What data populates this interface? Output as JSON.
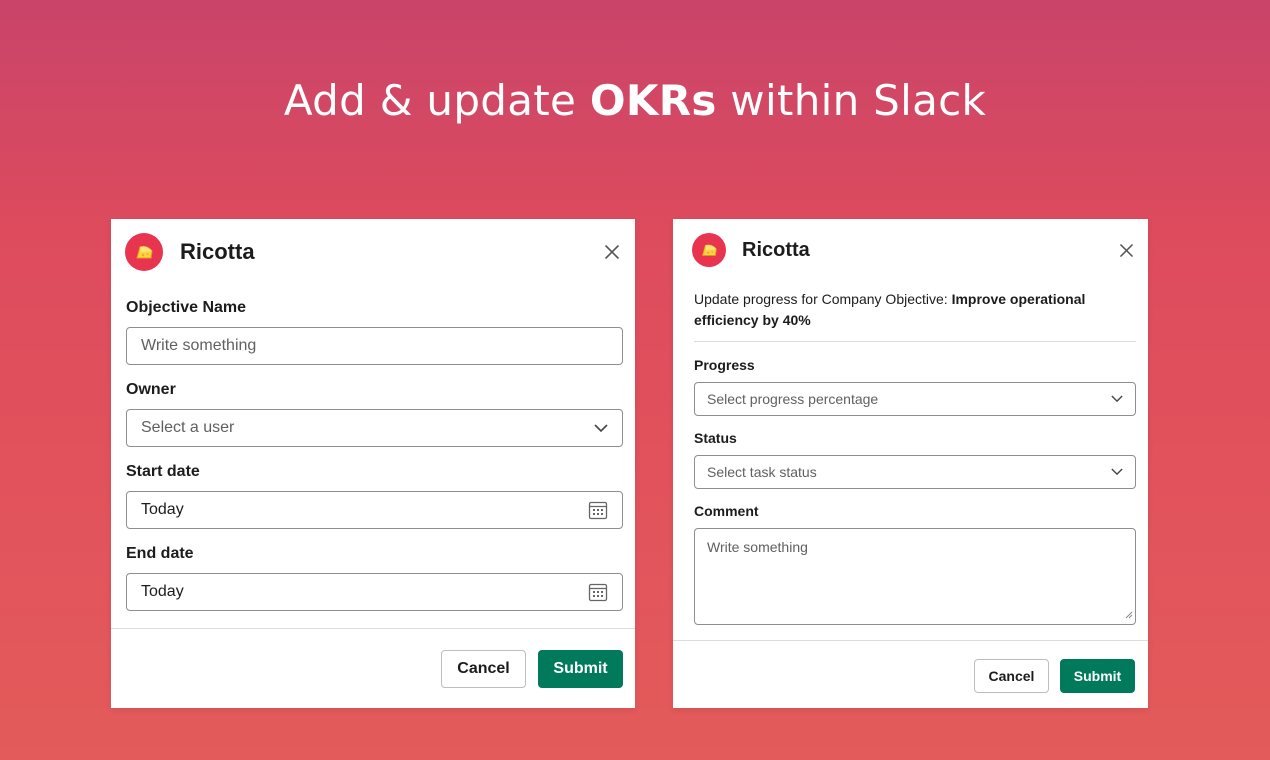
{
  "headline": {
    "pre": "Add & update ",
    "bold": "OKRs",
    "post": " within Slack"
  },
  "left_modal": {
    "app_name": "Ricotta",
    "fields": {
      "objective_label": "Objective Name",
      "objective_placeholder": "Write something",
      "owner_label": "Owner",
      "owner_placeholder": "Select a user",
      "start_label": "Start date",
      "start_value": "Today",
      "end_label": "End date",
      "end_value": "Today"
    },
    "cancel_label": "Cancel",
    "submit_label": "Submit"
  },
  "right_modal": {
    "app_name": "Ricotta",
    "intro_text": "Update progress for Company Objective: ",
    "intro_bold": "Improve operational efficiency by 40%",
    "progress_label": "Progress",
    "progress_placeholder": "Select progress percentage",
    "status_label": "Status",
    "status_placeholder": "Select task status",
    "comment_label": "Comment",
    "comment_placeholder": "Write something",
    "cancel_label": "Cancel",
    "submit_label": "Submit"
  },
  "colors": {
    "accent_green": "#007a5a",
    "logo_red": "#e8344f",
    "cheese_yellow": "#ffd23f"
  },
  "icons": [
    "cheese-icon",
    "close-icon",
    "chevron-down-icon",
    "calendar-icon",
    "resize-handle-icon"
  ]
}
